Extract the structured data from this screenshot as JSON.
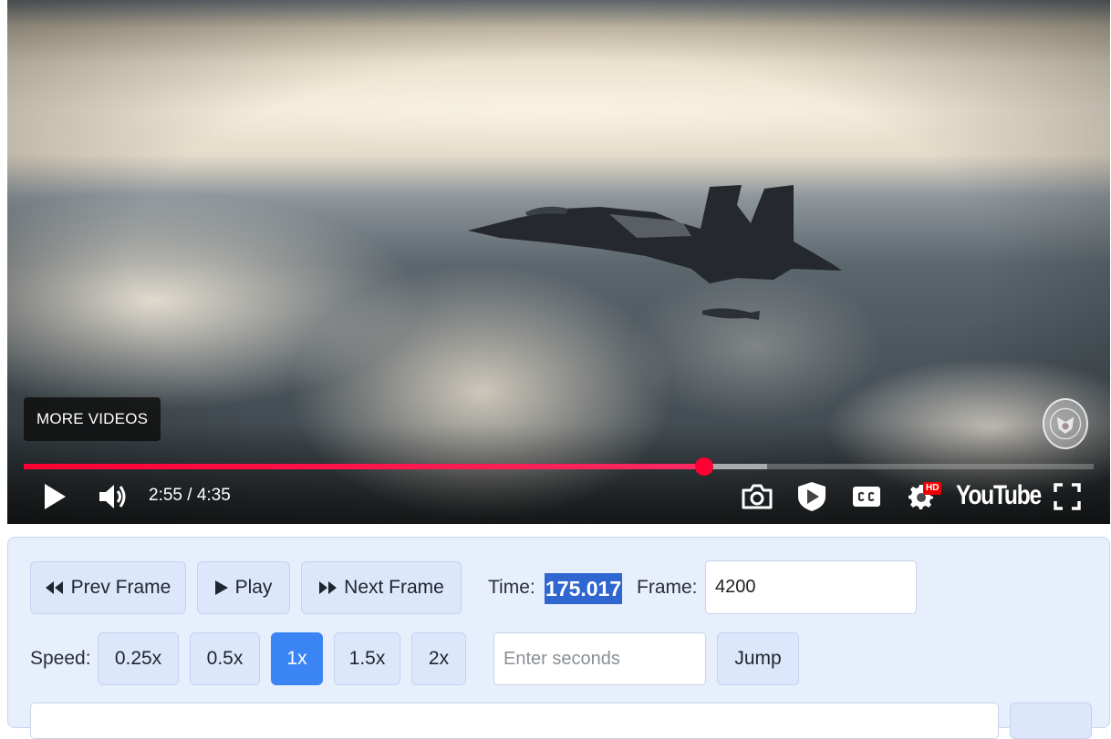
{
  "player": {
    "more_videos_label": "MORE VIDEOS",
    "current_time": "2:55",
    "duration": "4:35",
    "time_text": "2:55 / 4:35",
    "progress_played_fraction": 0.636,
    "progress_buffered_fraction": 0.695,
    "hd_badge": "HD",
    "brand_label": "YouTube",
    "icons": [
      "play-icon",
      "volume-icon",
      "camera-icon",
      "shield-play-icon",
      "cc-icon",
      "settings-icon",
      "fullscreen-icon"
    ],
    "accent_color": "#ff0033"
  },
  "frame_controls": {
    "prev_frame_label": "Prev Frame",
    "play_label": "Play",
    "next_frame_label": "Next Frame",
    "time_label": "Time:",
    "time_value": "175.017",
    "frame_label": "Frame:",
    "frame_value": "4200",
    "speed_label": "Speed:",
    "speeds": [
      "0.25x",
      "0.5x",
      "1x",
      "1.5x",
      "2x"
    ],
    "active_speed": "1x",
    "seek_placeholder": "Enter seconds",
    "jump_label": "Jump",
    "active_color": "#3a84f4"
  }
}
